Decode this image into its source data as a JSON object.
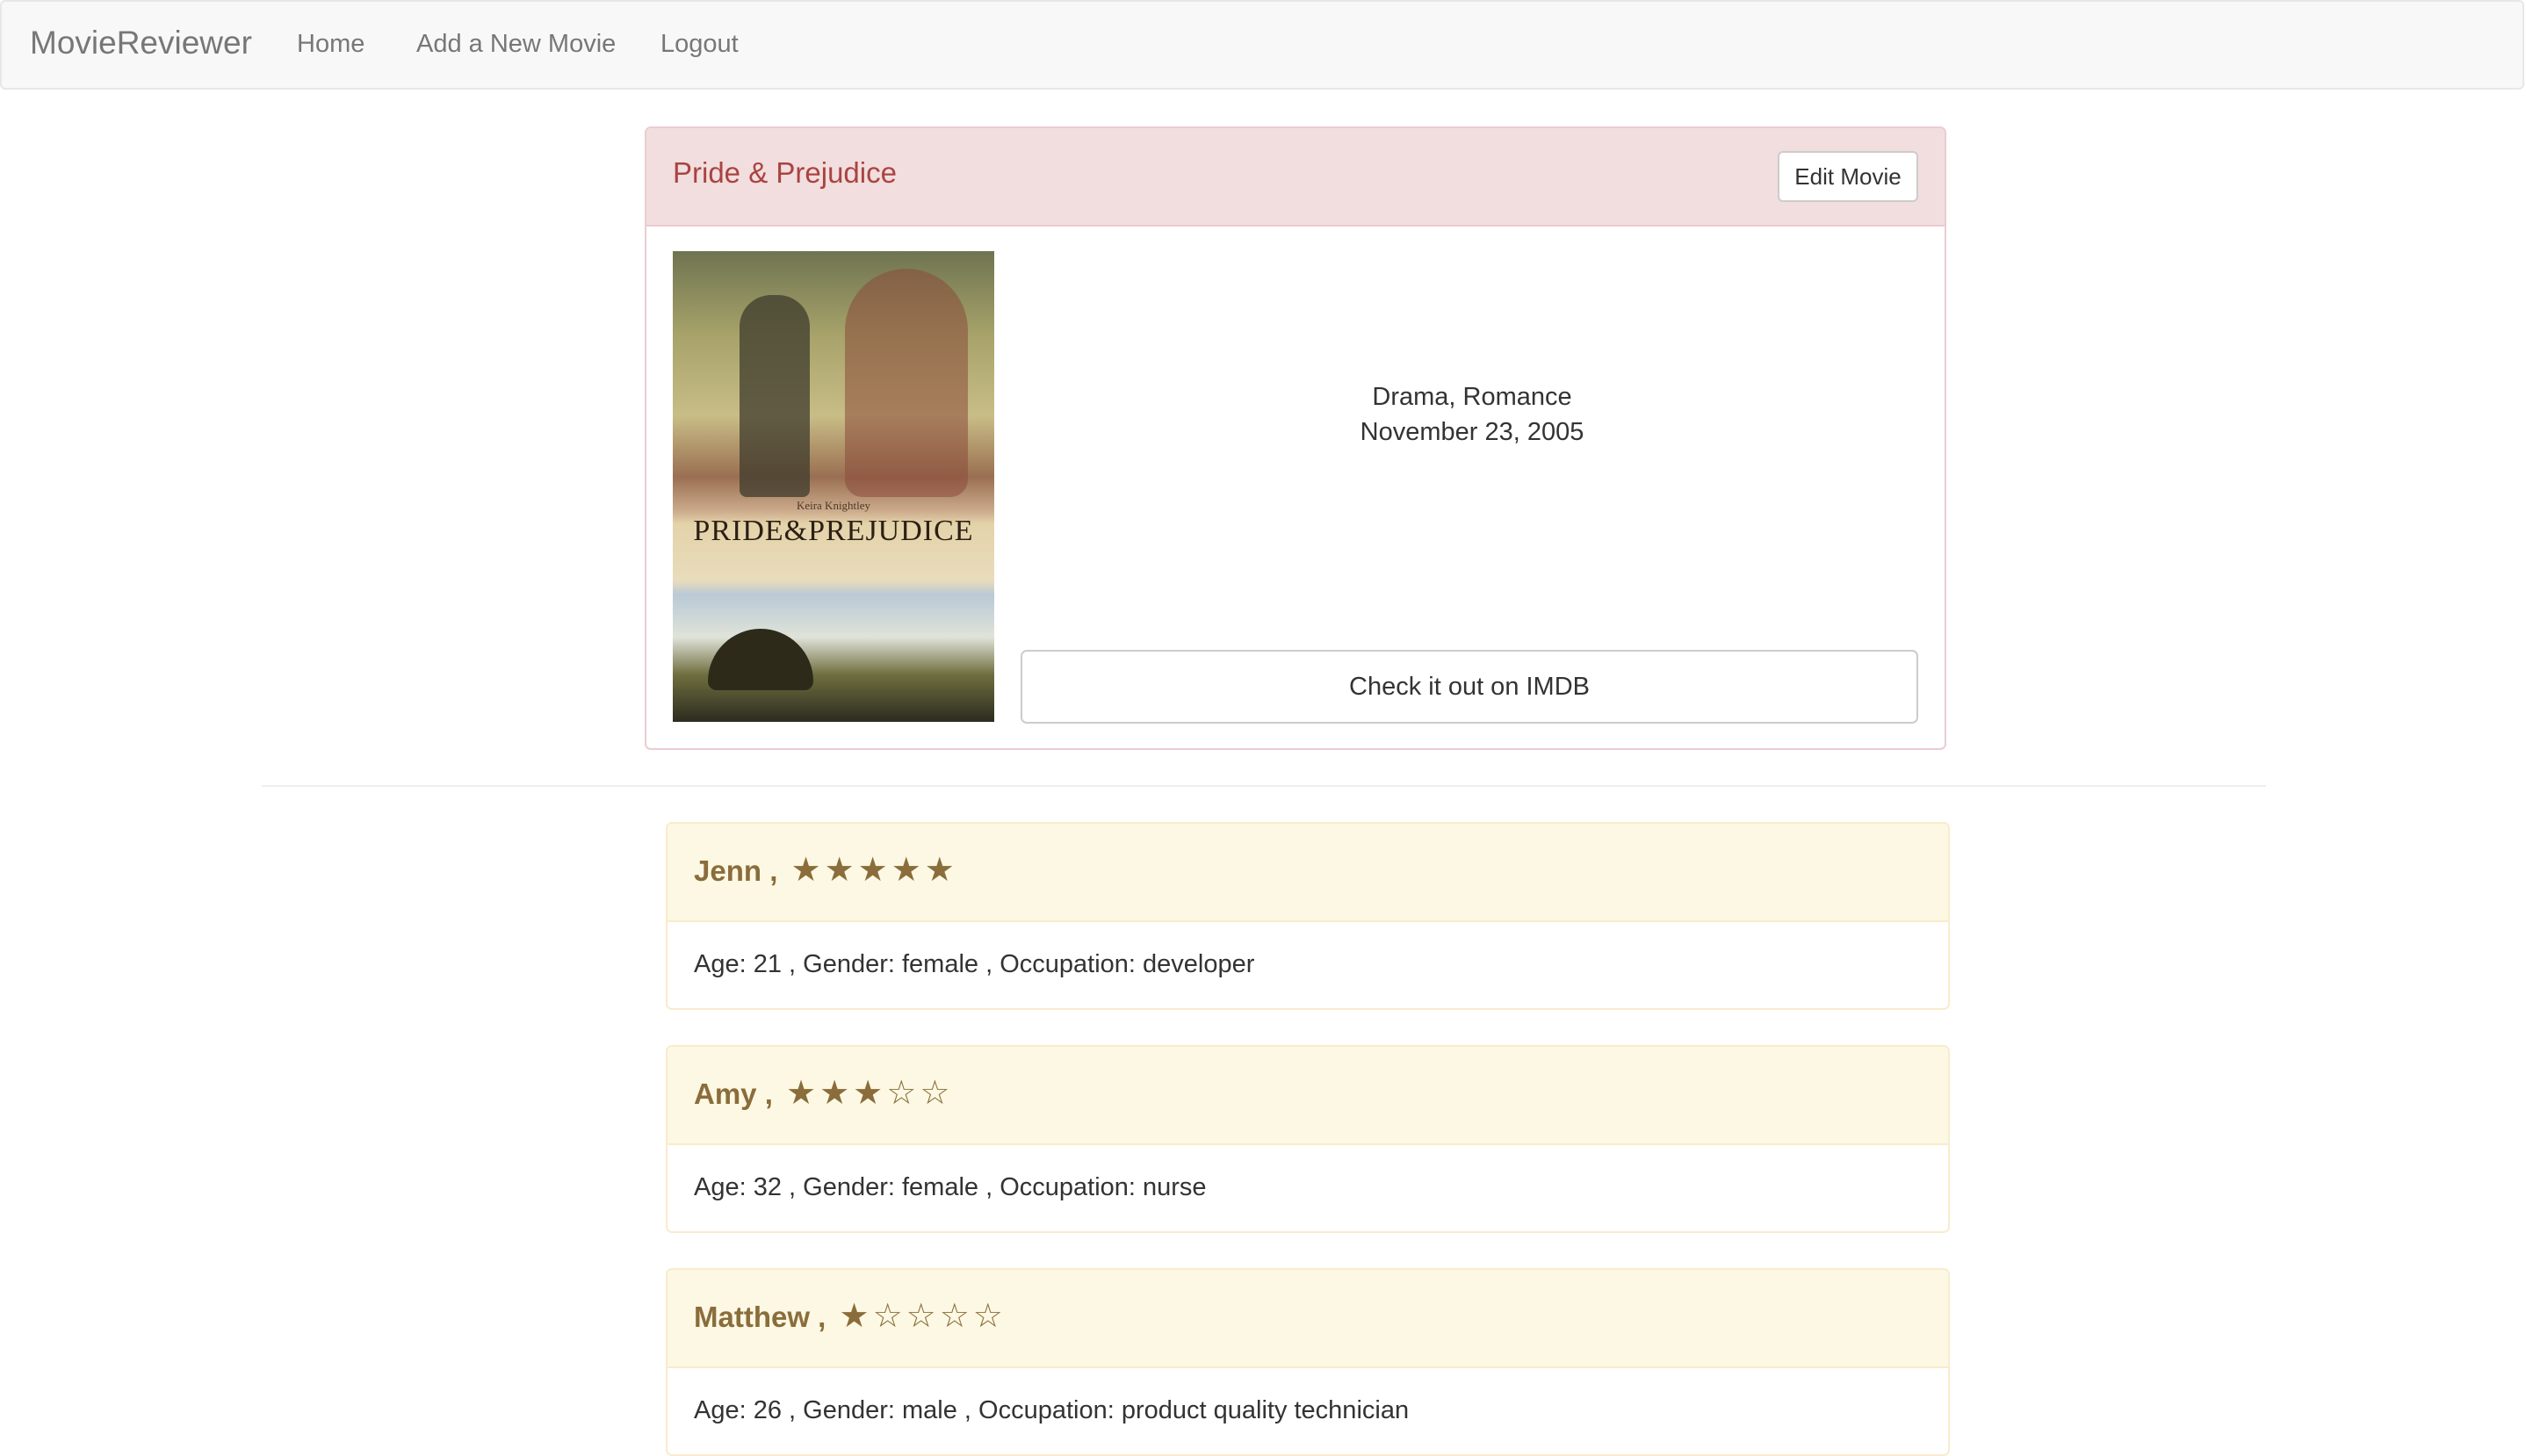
{
  "navbar": {
    "brand": "MovieReviewer",
    "links": [
      "Home",
      "Add a New Movie",
      "Logout"
    ]
  },
  "movie": {
    "title": "Pride & Prejudice",
    "edit_label": "Edit Movie",
    "poster": {
      "tagline": "Keira Knightley",
      "title": "PRIDE&PREJUDICE"
    },
    "genres": "Drama, Romance",
    "release_date": "November 23, 2005",
    "imdb_label": "Check it out on IMDB"
  },
  "reviews": [
    {
      "name": "Jenn ,",
      "stars": "★★★★★",
      "rating": 5,
      "details": "Age: 21 , Gender: female , Occupation: developer"
    },
    {
      "name": "Amy ,",
      "stars": "★★★☆☆",
      "rating": 3,
      "details": "Age: 32 , Gender: female , Occupation: nurse"
    },
    {
      "name": "Matthew ,",
      "stars": "★☆☆☆☆",
      "rating": 1,
      "details": "Age: 26 , Gender: male , Occupation: product quality technician"
    }
  ],
  "colors": {
    "danger_bg": "#f2dede",
    "danger_text": "#a94442",
    "warning_bg": "#fcf8e3",
    "warning_text": "#8a6d3b"
  }
}
